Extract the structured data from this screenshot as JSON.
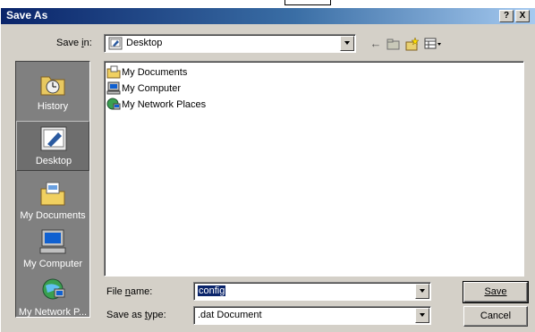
{
  "dialog": {
    "title": "Save As",
    "help_button": "?",
    "close_button": "X"
  },
  "save_in": {
    "label": "Save in:",
    "label_hotkey": "i",
    "value": "Desktop"
  },
  "toolbar": {
    "icons": [
      "back-icon",
      "up-folder-icon",
      "new-folder-icon",
      "views-menu-icon"
    ]
  },
  "places": [
    {
      "label": "History",
      "icon": "history-icon"
    },
    {
      "label": "Desktop",
      "icon": "desktop-icon",
      "selected": true
    },
    {
      "label": "My Documents",
      "icon": "my-documents-icon"
    },
    {
      "label": "My Computer",
      "icon": "my-computer-icon"
    },
    {
      "label": "My Network P...",
      "icon": "my-network-places-icon"
    }
  ],
  "files": [
    {
      "name": "My Documents",
      "icon": "folder-icon"
    },
    {
      "name": "My Computer",
      "icon": "computer-icon"
    },
    {
      "name": "My Network Places",
      "icon": "network-icon"
    }
  ],
  "file_name": {
    "label": "File name:",
    "value": "config"
  },
  "save_as_type": {
    "label": "Save as type:",
    "value": ".dat Document"
  },
  "buttons": {
    "save": "Save",
    "cancel": "Cancel"
  },
  "colors": {
    "title_start": "#0a246a",
    "title_end": "#a6caf0",
    "face": "#d4d0c8",
    "places_bg": "#808080",
    "selection": "#0a246a"
  }
}
